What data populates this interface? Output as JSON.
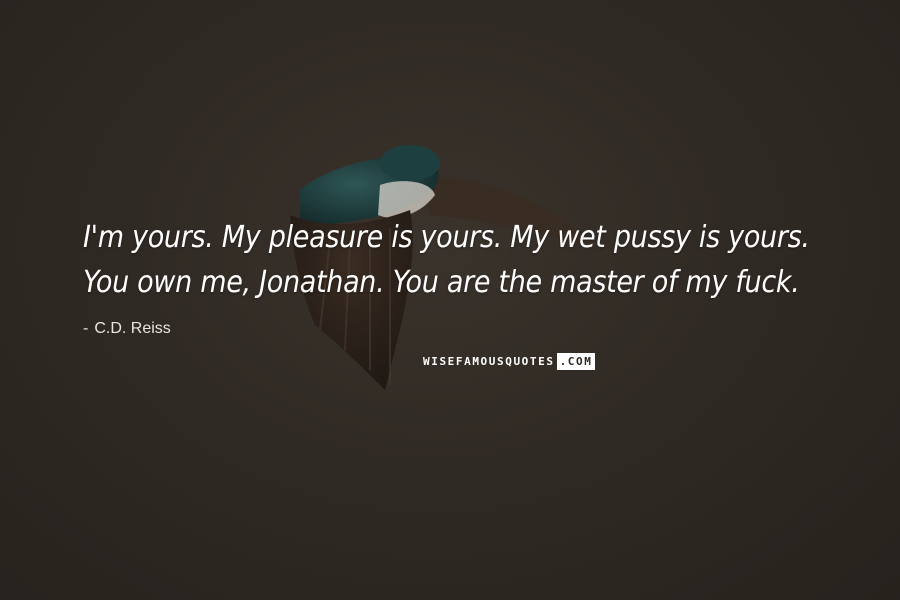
{
  "quote": {
    "text": "I'm yours. My pleasure is yours. My wet pussy is yours. You own me, Jonathan. You are the master of my fuck.",
    "author": "C.D. Reiss",
    "author_prefix": "-"
  },
  "watermark": {
    "main": "WISEFAMOUSQUOTES",
    "tld": ".COM"
  },
  "background": {
    "description_icon": "flying-swallow-bird",
    "colors": [
      "#302a24",
      "#1f3a3a",
      "#3c2e22"
    ]
  }
}
